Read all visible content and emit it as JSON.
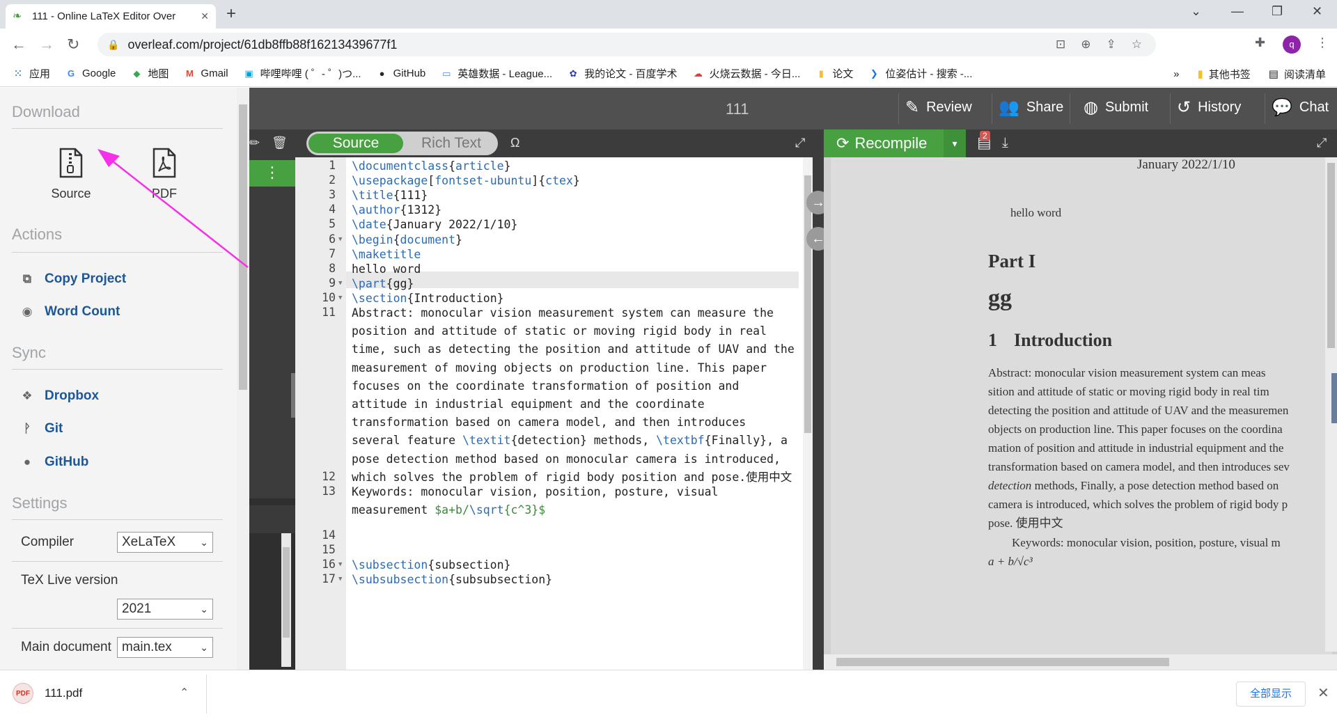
{
  "browser": {
    "tab_title": "111 - Online LaTeX Editor Over",
    "url": "overleaf.com/project/61db8ffb88f16213439677f1",
    "profile_initial": "q",
    "bookmarks": [
      {
        "icon": "apps-grid-icon",
        "label": "应用",
        "color": "#4285f4"
      },
      {
        "icon": "google-icon",
        "label": "Google",
        "color": "#4285f4"
      },
      {
        "icon": "maps-icon",
        "label": "地图",
        "color": "#34a853"
      },
      {
        "icon": "gmail-icon",
        "label": "Gmail",
        "color": "#ea4335"
      },
      {
        "icon": "bilibili-icon",
        "label": "哔哩哔哩 ( ゜- ゜)つ...",
        "color": "#00a1d6"
      },
      {
        "icon": "github-icon",
        "label": "GitHub",
        "color": "#24292e"
      },
      {
        "icon": "opgg-icon",
        "label": "英雄数据 - League...",
        "color": "#5383e8"
      },
      {
        "icon": "baidu-icon",
        "label": "我的论文 - 百度学术",
        "color": "#2932e1"
      },
      {
        "icon": "cloud-icon",
        "label": "火烧云数据 - 今日...",
        "color": "#e53935"
      },
      {
        "icon": "folder-icon",
        "label": "论文",
        "color": "#f6c026"
      },
      {
        "icon": "bing-icon",
        "label": "位姿估计 - 搜索 -...",
        "color": "#1a73e8"
      }
    ],
    "bookmarks_overflow": "»",
    "other_bookmarks": "其他书签",
    "reading_list": "阅读清单"
  },
  "left_panel": {
    "download_heading": "Download",
    "download_source": "Source",
    "download_pdf": "PDF",
    "actions_heading": "Actions",
    "copy_project": "Copy Project",
    "word_count": "Word Count",
    "sync_heading": "Sync",
    "dropbox": "Dropbox",
    "git": "Git",
    "github": "GitHub",
    "settings_heading": "Settings",
    "compiler_label": "Compiler",
    "compiler_value": "XeLaTeX",
    "texlive_label": "TeX Live version",
    "texlive_value": "2021",
    "main_doc_label": "Main document",
    "main_doc_value": "main.tex"
  },
  "topbar": {
    "project_name": "111",
    "review": "Review",
    "share": "Share",
    "submit": "Submit",
    "history": "History",
    "chat": "Chat"
  },
  "editor": {
    "source_label": "Source",
    "rich_text_label": "Rich Text",
    "omega_symbol": "Ω",
    "line_numbers": [
      "1",
      "2",
      "3",
      "4",
      "5",
      "6",
      "7",
      "8",
      "9",
      "10",
      "11",
      "12",
      "13",
      "14",
      "15",
      "16",
      "17"
    ]
  },
  "pdf": {
    "recompile": "Recompile",
    "log_badge": "2",
    "date": "January 2022/1/10",
    "hello": "hello word",
    "part": "Part I",
    "part_name": "gg",
    "section_num": "1",
    "section_title": "Introduction",
    "abstract_text": "Abstract: monocular vision measurement system can meas\nsition and attitude of static or moving rigid body in real tim\ndetecting the position and attitude of UAV and the measuremen\nobjects on production line. This paper focuses on the coordina\nmation of position and attitude in industrial equipment and the\ntransformation based on camera model, and then introduces sev",
    "abstract_tail": "methods, Finally, a pose detection method based on\ncamera is introduced, which solves the problem of rigid body p\npose. 使用中文",
    "italic_word": "detection",
    "keywords": "Keywords: monocular vision, position, posture, visual m",
    "formula": "a + b/√c³"
  },
  "downloads": {
    "file_name": "111.pdf",
    "show_all": "全部显示"
  },
  "colors": {
    "overleaf_green": "#47a141",
    "link_blue": "#1d5797",
    "annotation_arrow": "#f530e8"
  }
}
